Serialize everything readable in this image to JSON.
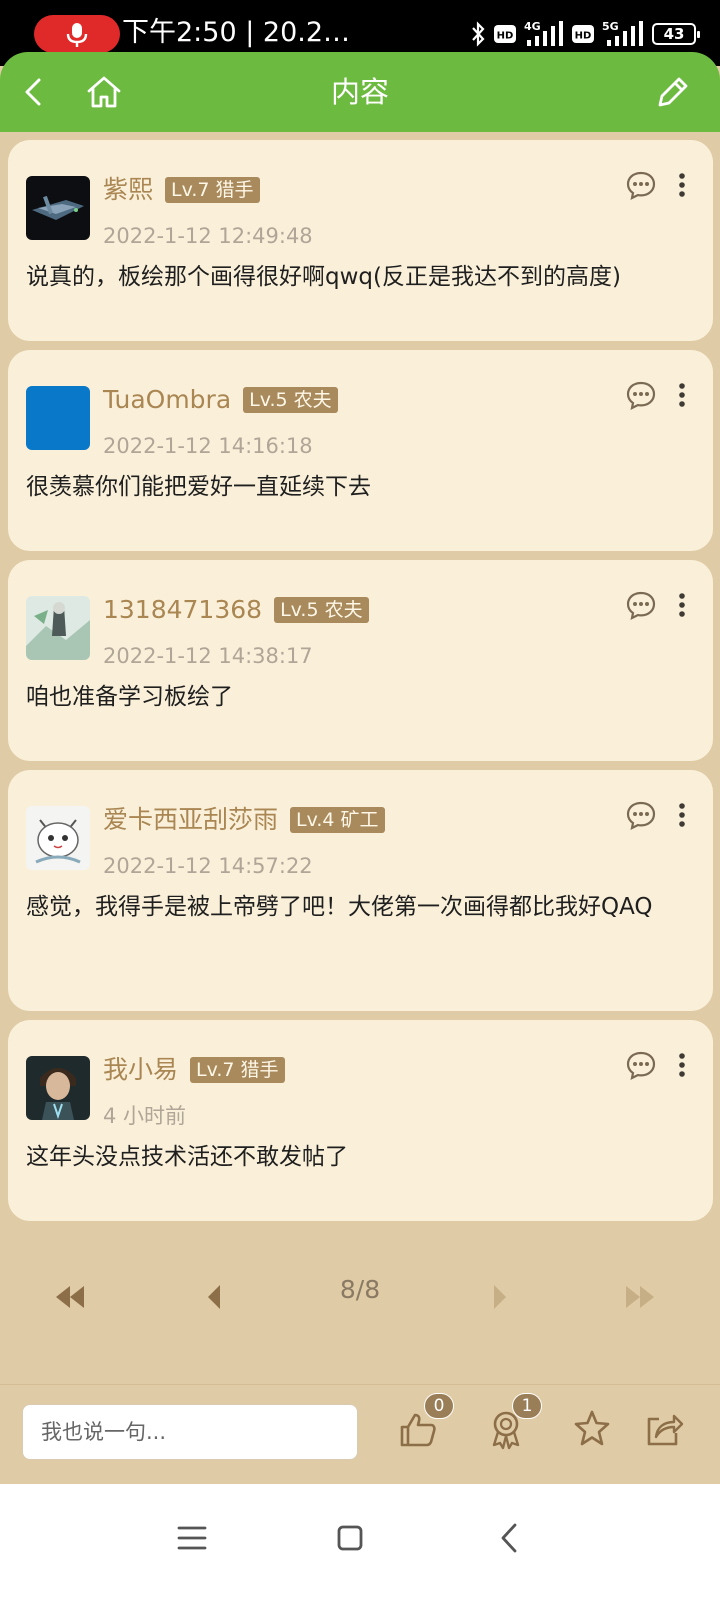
{
  "status_bar": {
    "time": "下午2:50 | 20.2…",
    "battery": "43",
    "network_1": "4G",
    "network_2": "5G",
    "hd_1": "HD",
    "hd_2": "HD"
  },
  "header": {
    "title": "内容"
  },
  "comments": [
    {
      "username": "紫熙",
      "level": "Lv.7 猎手",
      "time": "2022-1-12 12:49:48",
      "content": "说真的，板绘那个画得很好啊qwq(反正是我达不到的高度)"
    },
    {
      "username": "TuaOmbra",
      "level": "Lv.5 农夫",
      "time": "2022-1-12 14:16:18",
      "content": "很羡慕你们能把爱好一直延续下去"
    },
    {
      "username": "1318471368",
      "level": "Lv.5 农夫",
      "time": "2022-1-12 14:38:17",
      "content": "咱也准备学习板绘了"
    },
    {
      "username": "爱卡西亚刮莎雨",
      "level": "Lv.4 矿工",
      "time": "2022-1-12 14:57:22",
      "content": "感觉，我得手是被上帝劈了吧！大佬第一次画得都比我好QAQ"
    },
    {
      "username": "我小易",
      "level": "Lv.7 猎手",
      "time": "4 小时前",
      "content": "这年头没点技术活还不敢发帖了"
    }
  ],
  "pagination": {
    "indicator": "8/8"
  },
  "bottom_bar": {
    "input_placeholder": "我也说一句...",
    "like_count": "0",
    "award_count": "1"
  },
  "colors": {
    "header_green": "#6cba3f",
    "page_bg": "#dfcba5",
    "card_bg": "#faf0da",
    "username": "#a98652",
    "level_badge": "#a98a5c"
  },
  "icons": {
    "header_left": [
      "back-icon",
      "home-icon"
    ],
    "header_right": "edit-icon",
    "card_actions": [
      "comment-bubble-icon",
      "more-vertical-icon"
    ],
    "bottom_bar": [
      "like-icon",
      "award-icon",
      "star-icon",
      "share-icon"
    ],
    "nav": [
      "menu-icon",
      "home-square-icon",
      "back-chevron-icon"
    ]
  }
}
